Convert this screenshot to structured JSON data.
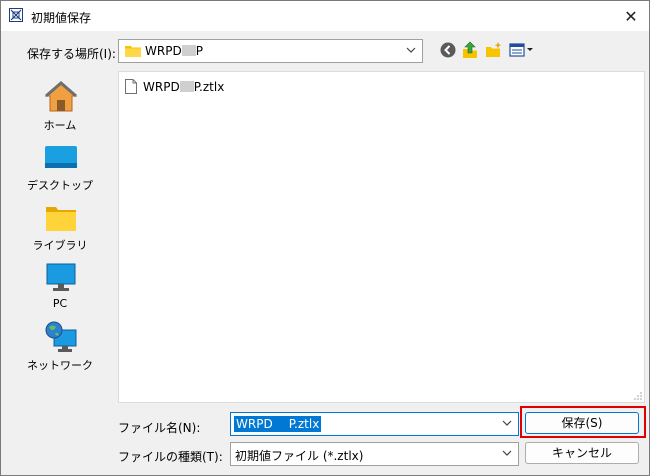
{
  "window": {
    "title": "初期値保存"
  },
  "lookin": {
    "label": "保存する場所(I):",
    "value_prefix": "WRPD",
    "value_suffix": "P"
  },
  "places": [
    {
      "label": "ホーム",
      "icon": "home-icon"
    },
    {
      "label": "デスクトップ",
      "icon": "desktop-icon"
    },
    {
      "label": "ライブラリ",
      "icon": "library-icon"
    },
    {
      "label": "PC",
      "icon": "pc-icon"
    },
    {
      "label": "ネットワーク",
      "icon": "network-icon"
    }
  ],
  "files": [
    {
      "name_prefix": "WRPD",
      "name_suffix": "P.ztlx",
      "icon": "document-icon"
    }
  ],
  "filename": {
    "label": "ファイル名(N):",
    "value_prefix": "WRPD",
    "value_suffix": "P.ztlx"
  },
  "filetype": {
    "label": "ファイルの種類(T):",
    "value": "初期値ファイル (*.ztlx)"
  },
  "buttons": {
    "save": "保存(S)",
    "cancel": "キャンセル"
  },
  "colors": {
    "accent": "#0078d4",
    "highlight": "#e00000",
    "folder": "#f8c400"
  }
}
